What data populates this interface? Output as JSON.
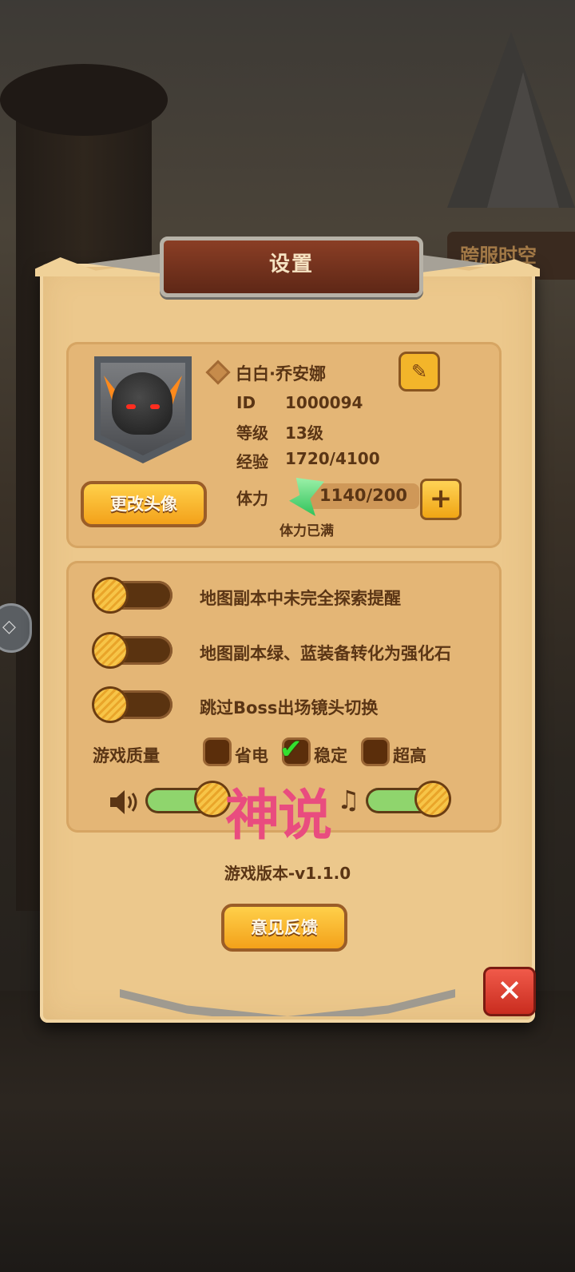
{
  "background": {
    "sign_text": "跨服时空"
  },
  "dialog": {
    "title": "设置"
  },
  "profile": {
    "player_name": "白白·乔安娜",
    "id_label": "ID",
    "id_value": "1000094",
    "level_label": "等级",
    "level_value": "13级",
    "exp_label": "经验",
    "exp_value": "1720/4100",
    "stamina_label": "体力",
    "stamina_value": "1140/200",
    "stamina_status": "体力已满",
    "change_avatar_label": "更改头像"
  },
  "options": [
    {
      "label": "地图副本中未完全探索提醒",
      "enabled": false
    },
    {
      "label": "地图副本绿、蓝装备转化为强化石",
      "enabled": false
    },
    {
      "label": "跳过Boss出场镜头切换",
      "enabled": false
    }
  ],
  "quality": {
    "label": "游戏质量",
    "choices": [
      "省电",
      "稳定",
      "超高"
    ],
    "selected": "稳定"
  },
  "audio": {
    "sound_level": 1.0,
    "music_level": 1.0
  },
  "watermark": "神说",
  "version_text": "游戏版本-v1.1.0",
  "feedback_label": "意见反馈",
  "icons": {
    "edit": "edit-icon",
    "close": "close-icon",
    "speaker": "speaker-icon",
    "music": "music-note-icon",
    "stamina": "lightning-icon",
    "plus": "plus-icon"
  }
}
